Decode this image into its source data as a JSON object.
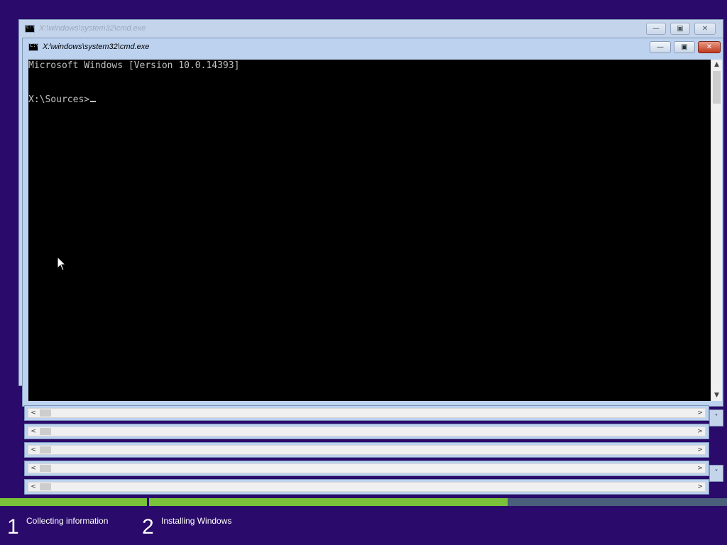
{
  "back_window": {
    "title": "X:\\windows\\system32\\cmd.exe",
    "controls": {
      "minimize": "—",
      "maximize": "▣",
      "close": "✕"
    }
  },
  "front_window": {
    "title": "X:\\windows\\system32\\cmd.exe",
    "controls": {
      "minimize": "—",
      "maximize": "▣",
      "close": "✕"
    }
  },
  "console": {
    "line1": "Microsoft Windows [Version 10.0.14393]",
    "prompt": "X:\\Sources>"
  },
  "scroll_glyphs": {
    "up": "▲",
    "down": "▼",
    "left": "<",
    "right": ">",
    "down_chevron": "˅"
  },
  "setup": {
    "steps": [
      {
        "number": "1",
        "label": "Collecting information"
      },
      {
        "number": "2",
        "label": "Installing Windows"
      }
    ],
    "progress": [
      1.0,
      0.62
    ]
  },
  "colors": {
    "background": "#2a0a6a",
    "progress_fill": "#79c23a",
    "console_bg": "#000000"
  },
  "icons": [
    "cmd-icon",
    "minimize-icon",
    "maximize-icon",
    "close-icon",
    "mouse-pointer-icon"
  ]
}
